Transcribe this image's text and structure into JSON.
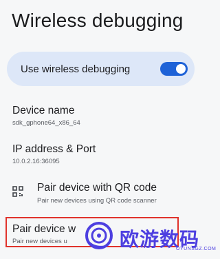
{
  "page": {
    "title": "Wireless debugging"
  },
  "toggle": {
    "label": "Use wireless debugging",
    "state": true,
    "color": "#1e62d7",
    "card_color": "#dde7f8"
  },
  "device": {
    "title": "Device name",
    "value": "sdk_gphone64_x86_64"
  },
  "ip": {
    "title": "IP address & Port",
    "value": "10.0.2.16:36095"
  },
  "qr_pair": {
    "title": "Pair device with QR code",
    "subtitle": "Pair new devices using QR code scanner",
    "icon": "qr-code-icon"
  },
  "code_pair": {
    "title": "Pair device w",
    "subtitle": "Pair new devices u",
    "highlight_color": "#e0322b"
  },
  "watermark": {
    "text": "欧游数码",
    "sub": "OYUNSGZ.COM",
    "color": "#4d3fe0"
  }
}
